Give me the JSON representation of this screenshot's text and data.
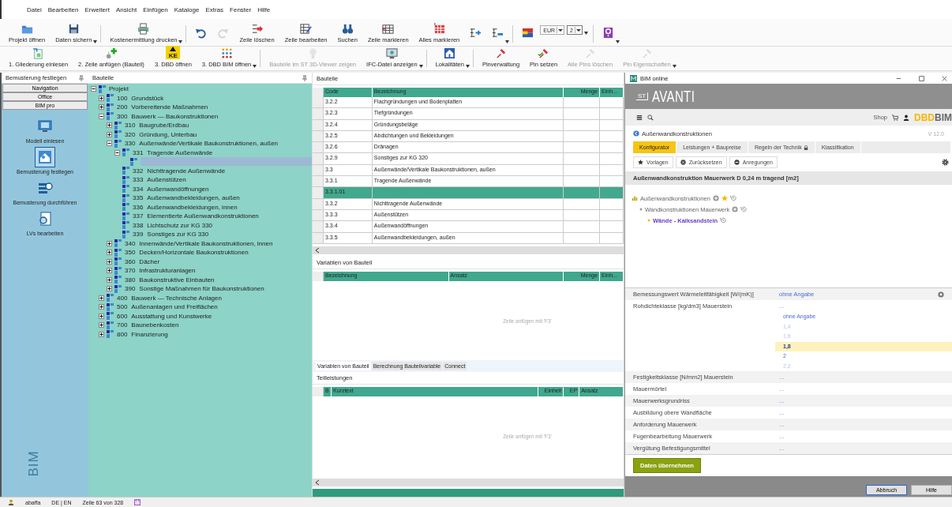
{
  "menu": [
    "Datei",
    "Bearbeiten",
    "Erweitert",
    "Ansicht",
    "Einfügen",
    "Kataloge",
    "Extras",
    "Fenster",
    "Hilfe"
  ],
  "toolbar_main": [
    {
      "kind": "button",
      "label": "Projekt öffnen",
      "dropdown": false,
      "disabled": false
    },
    {
      "kind": "button",
      "label": "Daten sichern",
      "dropdown": true,
      "disabled": false
    },
    {
      "kind": "separator"
    },
    {
      "kind": "button",
      "label": "Kostenermittlung drucken",
      "dropdown": true,
      "disabled": false
    },
    {
      "kind": "separator"
    },
    {
      "kind": "icon",
      "dropdown": false,
      "disabled": false
    },
    {
      "kind": "icon",
      "dropdown": false,
      "disabled": true
    },
    {
      "kind": "button",
      "label": "Zeile löschen",
      "dropdown": false,
      "disabled": false
    },
    {
      "kind": "button",
      "label": "Zeile bearbeiten",
      "dropdown": false,
      "disabled": false
    },
    {
      "kind": "button",
      "label": "Suchen",
      "dropdown": false,
      "disabled": false
    },
    {
      "kind": "button",
      "label": "Zeile markieren",
      "dropdown": false,
      "disabled": false
    },
    {
      "kind": "button",
      "label": "Alles markieren",
      "dropdown": false,
      "disabled": false
    },
    {
      "kind": "icon",
      "dropdown": false,
      "disabled": false
    },
    {
      "kind": "icon",
      "dropdown": true,
      "disabled": false
    },
    {
      "kind": "separator"
    },
    {
      "kind": "icon",
      "dropdown": false,
      "disabled": false
    },
    {
      "kind": "combo",
      "value": "EUR",
      "dropdown": false,
      "disabled": false
    },
    {
      "kind": "combo",
      "value": "2",
      "dropdown": true,
      "disabled": false
    },
    {
      "kind": "separator"
    },
    {
      "kind": "icon",
      "dropdown": true,
      "disabled": false
    }
  ],
  "toolbar_workflow": [
    {
      "kind": "button",
      "label": "1. Gliederung einlesen",
      "dropdown": false,
      "disabled": false
    },
    {
      "kind": "button",
      "label": "2. Zeile anfügen (Bauteil)",
      "dropdown": false,
      "disabled": false
    },
    {
      "kind": "button",
      "label": "3. DBD öffnen",
      "icon_text": "KE",
      "dropdown": false,
      "disabled": false
    },
    {
      "kind": "button",
      "label": "3. DBD BIM öffnen",
      "dropdown": true,
      "disabled": false
    },
    {
      "kind": "separator"
    },
    {
      "kind": "button",
      "label": "Bauteile im ST 3D-Viewer zeigen",
      "dropdown": false,
      "disabled": true
    },
    {
      "kind": "button",
      "label": "IFC-Datei anzeigen",
      "dropdown": true,
      "disabled": false
    },
    {
      "kind": "separator"
    },
    {
      "kind": "button",
      "label": "Lokalitäten",
      "dropdown": true,
      "disabled": false
    },
    {
      "kind": "separator"
    },
    {
      "kind": "button",
      "label": "Pinverwaltung",
      "dropdown": false,
      "disabled": false
    },
    {
      "kind": "button",
      "label": "Pin setzen",
      "dropdown": false,
      "disabled": false
    },
    {
      "kind": "button",
      "label": "Alle Pins löschen",
      "dropdown": false,
      "disabled": true
    },
    {
      "kind": "button",
      "label": "Pin Eigenschaften",
      "dropdown": true,
      "disabled": true
    }
  ],
  "sidebar": {
    "title": "Bemusterung festlegen",
    "nav_buttons": [
      "Navigation",
      "Office",
      "BIM pro"
    ],
    "tasks": [
      {
        "label": "Modell einlesen",
        "selected": false
      },
      {
        "label": "Bemusterung festlegen",
        "selected": true
      },
      {
        "label": "Bemusterung durchführen",
        "selected": false
      },
      {
        "label": "LVs bearbeiten",
        "selected": false
      }
    ],
    "vertical_label": "BIM"
  },
  "tree_panel": {
    "title": "Bauteile",
    "items": [
      {
        "name": "Projekt",
        "expanded": true,
        "selected": false,
        "children": [
          {
            "code": "100",
            "name": "Grundstück",
            "expanded": false,
            "selected": false
          },
          {
            "code": "200",
            "name": "Vorbereitende Maßnahmen",
            "expanded": false,
            "selected": false
          },
          {
            "code": "300",
            "name": "Bauwerk — Baukonstruktionen",
            "expanded": true,
            "selected": false,
            "children": [
              {
                "code": "310",
                "name": "Baugrube/Erdbau",
                "expanded": false,
                "selected": false
              },
              {
                "code": "320",
                "name": "Gründung, Unterbau",
                "expanded": false,
                "selected": false
              },
              {
                "code": "330",
                "name": "Außenwände/Vertikale Baukonstruktionen, außen",
                "expanded": true,
                "selected": false,
                "children": [
                  {
                    "code": "331",
                    "name": "Tragende Außenwände",
                    "expanded": true,
                    "selected": false,
                    "children": [
                      {
                        "selected": true
                      }
                    ]
                  },
                  {
                    "code": "332",
                    "name": "Nichttragende Außenwände",
                    "selected": false
                  },
                  {
                    "code": "333",
                    "name": "Außenstützen",
                    "selected": false
                  },
                  {
                    "code": "334",
                    "name": "Außenwandöffnungen",
                    "selected": false
                  },
                  {
                    "code": "335",
                    "name": "Außenwandbekleidungen, außen",
                    "selected": false
                  },
                  {
                    "code": "336",
                    "name": "Außenwandbekleidungen, innen",
                    "selected": false
                  },
                  {
                    "code": "337",
                    "name": "Elementierte Außenwandkonstruktionen",
                    "selected": false
                  },
                  {
                    "code": "338",
                    "name": "Lichtschutz zur KG 330",
                    "selected": false
                  },
                  {
                    "code": "339",
                    "name": "Sonstiges zur KG 330",
                    "selected": false
                  }
                ]
              },
              {
                "code": "340",
                "name": "Innenwände/Vertikale Baukonstruktionen, innen",
                "expanded": false,
                "selected": false
              },
              {
                "code": "350",
                "name": "Decken/Horizontale Baukonstruktionen",
                "expanded": false,
                "selected": false
              },
              {
                "code": "360",
                "name": "Dächer",
                "expanded": false,
                "selected": false
              },
              {
                "code": "370",
                "name": "Infrastrukturanlagen",
                "expanded": false,
                "selected": false
              },
              {
                "code": "380",
                "name": "Baukonstruktive Einbauten",
                "expanded": false,
                "selected": false
              },
              {
                "code": "390",
                "name": "Sonstige Maßnahmen für Baukonstruktionen",
                "expanded": false,
                "selected": false
              }
            ]
          },
          {
            "code": "400",
            "name": "Bauwerk — Technische Anlagen",
            "expanded": false,
            "selected": false
          },
          {
            "code": "500",
            "name": "Außenanlagen und Freiflächen",
            "expanded": false,
            "selected": false
          },
          {
            "code": "600",
            "name": "Ausstattung und Kunstwerke",
            "expanded": false,
            "selected": false
          },
          {
            "code": "700",
            "name": "Baunebenkosten",
            "expanded": false,
            "selected": false
          },
          {
            "code": "800",
            "name": "Finanzierung",
            "expanded": false,
            "selected": false
          }
        ]
      }
    ]
  },
  "components_panel": {
    "title": "Bauteile",
    "columns": [
      "Code",
      "Bezeichnung",
      "Menge",
      "Einh..."
    ],
    "rows": [
      {
        "code": "3.2.2",
        "name": "Flachgründungen und Bodenplatten",
        "selected": false
      },
      {
        "code": "3.2.3",
        "name": "Tiefgründungen",
        "selected": false
      },
      {
        "code": "3.2.4",
        "name": "Gründungsbeläge",
        "selected": false
      },
      {
        "code": "3.2.5",
        "name": "Abdichtungen und Bekleidungen",
        "selected": false
      },
      {
        "code": "3.2.6",
        "name": "Dränagen",
        "selected": false
      },
      {
        "code": "3.2.9",
        "name": "Sonstiges zur KG 320",
        "selected": false
      },
      {
        "code": "3.3",
        "name": "Außenwände/Vertikale Baukonstruktionen, außen",
        "selected": false
      },
      {
        "code": "3.3.1",
        "name": "Tragende Außenwände",
        "selected": false
      },
      {
        "code": "3.3.1.01",
        "selected": true
      },
      {
        "code": "3.3.2",
        "name": "Nichttragende Außenwände",
        "selected": false
      },
      {
        "code": "3.3.3",
        "name": "Außenstützen",
        "selected": false
      },
      {
        "code": "3.3.4",
        "name": "Außenwandöffnungen",
        "selected": false
      },
      {
        "code": "3.3.5",
        "name": "Außenwandbekleidungen, außen",
        "selected": false
      }
    ]
  },
  "variables": {
    "title": "Variablen von Bauteil",
    "columns": [
      "Bezeichnung",
      "Ansatz",
      "Menge",
      "Einh..."
    ],
    "empty_hint": "Zeile anfügen mit 'F3'"
  },
  "detail_tabs": [
    {
      "label": "Variablen von Bauteil",
      "selected": true
    },
    {
      "label": "Berechnung Bauteilvariable",
      "selected": false
    },
    {
      "label": "Connect",
      "selected": false
    }
  ],
  "subitems": {
    "title": "Teilleistungen",
    "columns": [
      "B",
      "Kurztext",
      "Einheit",
      "EP",
      "Ansatz"
    ],
    "empty_hint": "Zeile anfügen mit 'F3'"
  },
  "status_bar": {
    "user": "abaffa",
    "language": "DE | EN",
    "position": "Zeile 63 von 328"
  },
  "bim_window": {
    "title": "BIM online",
    "logo": {
      "mark": "ST",
      "name": "AVANTI"
    },
    "shop": "Shop",
    "brand": {
      "first": "DBD",
      "second": "BIM"
    },
    "breadcrumb": "Außenwandkonstruktionen",
    "version": "V 12.0",
    "tabs": [
      {
        "label": "Konfigurator",
        "locked": false,
        "selected": true
      },
      {
        "label": "Leistungen + Baupreise",
        "locked": false,
        "selected": false
      },
      {
        "label": "Regeln der Technik",
        "locked": true,
        "selected": false
      },
      {
        "label": "Klassifikation",
        "locked": false,
        "selected": false
      }
    ],
    "actions": [
      "Vorlagen",
      "Zurücksetzen",
      "Anregungen"
    ],
    "heading": "Außenwandkonstruktion Mauerwerk D 0,24 m tragend [m2]",
    "tree": [
      {
        "label": "Außenwandkonstruktionen",
        "favorite": true,
        "selected": false
      },
      {
        "label": "Wandkonstruktionen Mauerwerk",
        "favorite": false,
        "selected": false
      },
      {
        "label": "Wände - Kalksandstein",
        "favorite": false,
        "selected": true
      }
    ],
    "properties": [
      {
        "label": "Bemessungswert Wärmeleitfähigkeit [W/(mK)]",
        "value": "ohne Angabe",
        "settings": true
      },
      {
        "label": "Rohdichteklasse [kg/dm3] Mauerstein",
        "value": "...",
        "settings": false,
        "options": [
          {
            "label": "ohne Angabe",
            "available": true,
            "selected": false
          },
          {
            "label": "1,4",
            "available": false,
            "selected": false
          },
          {
            "label": "1,6",
            "available": false,
            "selected": false
          },
          {
            "label": "1,8",
            "available": true,
            "selected": true
          },
          {
            "label": "2",
            "available": true,
            "selected": false
          },
          {
            "label": "2,2",
            "available": false,
            "selected": false
          }
        ]
      },
      {
        "label": "Festigkeitsklasse [N/mm2] Mauerstein",
        "value": "...",
        "settings": false
      },
      {
        "label": "Mauermörtel",
        "value": "...",
        "settings": false
      },
      {
        "label": "Mauerwerksgrundriss",
        "value": "...",
        "settings": false
      },
      {
        "label": "Ausbildung obere Wandfläche",
        "value": "...",
        "settings": false
      },
      {
        "label": "Anforderung Mauerwerk",
        "value": "...",
        "settings": false
      },
      {
        "label": "Fugenbearbeitung Mauerwerk",
        "value": "...",
        "settings": false
      },
      {
        "label": "Vergütung Befestigungsmittel",
        "value": "...",
        "settings": false
      }
    ],
    "apply_button": "Daten übernehmen",
    "footer_buttons": [
      "Abbruch",
      "Hilfe"
    ]
  }
}
